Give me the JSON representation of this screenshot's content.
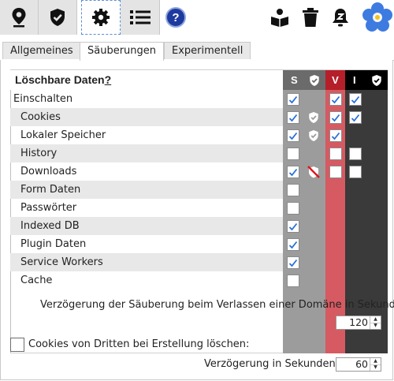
{
  "toolbar": {
    "buttons": [
      {
        "icon": "location-pin-icon"
      },
      {
        "icon": "shield-check-icon"
      },
      {
        "icon": "gear-icon",
        "active": true
      },
      {
        "icon": "list-icon"
      }
    ],
    "help_label": "?",
    "right_icons": [
      "book-reader-icon",
      "trash-icon",
      "bell-z-icon",
      "forget-me-not-logo"
    ]
  },
  "tabs": [
    {
      "label": "Allgemeines"
    },
    {
      "label": "Säuberungen",
      "active": true
    },
    {
      "label": "Experimentell"
    }
  ],
  "table": {
    "header": {
      "title": "Löschbare Daten",
      "help": "?",
      "col_s": "S",
      "col_v": "V",
      "col_i": "I"
    },
    "rows": [
      {
        "label": "Einschalten",
        "s": true,
        "s_shield": false,
        "v": true,
        "i": true
      },
      {
        "label": "Cookies",
        "s": true,
        "s_shield": true,
        "v": true,
        "i": true
      },
      {
        "label": "Lokaler Speicher",
        "s": true,
        "s_shield": true,
        "v": true,
        "i": null
      },
      {
        "label": "History",
        "s": false,
        "s_shield": false,
        "v": false,
        "i": false
      },
      {
        "label": "Downloads",
        "s": true,
        "s_shield": false,
        "s_forbidden": true,
        "v": false,
        "i": false
      },
      {
        "label": "Form Daten",
        "s": false,
        "v": null,
        "i": null
      },
      {
        "label": "Passwörter",
        "s": false,
        "v": null,
        "i": null
      },
      {
        "label": "Indexed DB",
        "s": true,
        "v": null,
        "i": null
      },
      {
        "label": "Plugin Daten",
        "s": true,
        "v": null,
        "i": null
      },
      {
        "label": "Service Workers",
        "s": true,
        "v": null,
        "i": null
      },
      {
        "label": "Cache",
        "s": false,
        "v": null,
        "i": null
      }
    ]
  },
  "delay_domain": {
    "label": "Verzögerung der Säuberung beim Verlassen einer Domäne in Sekunden:",
    "value": "120"
  },
  "third_party": {
    "label": "Cookies von Dritten bei Erstellung löschen:",
    "checked": false
  },
  "delay_seconds": {
    "label": "Verzögerung in Sekunden:",
    "value": "60"
  },
  "colors": {
    "s_col": "#9c9c9c",
    "v_col": "#d65a61",
    "i_col": "#3a3a3a",
    "check": "#2a6fdb"
  }
}
